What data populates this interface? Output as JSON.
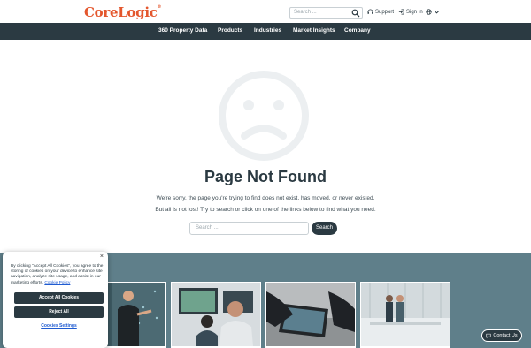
{
  "header": {
    "logo": "CoreLogic",
    "logo_mark": "®",
    "search_placeholder": "Search ...",
    "support": "Support",
    "signin": "Sign In"
  },
  "nav": {
    "items": [
      "360 Property Data",
      "Products",
      "Industries",
      "Market Insights",
      "Company"
    ]
  },
  "notfound": {
    "title": "Page Not Found",
    "line1": "We're sorry, the page you're trying to find does not exist, has moved, or never existed.",
    "line2": "But all is not lost! Try to search or click on one of the links below to find what you need.",
    "search_placeholder": "Search ...",
    "search_button": "Search"
  },
  "cookie": {
    "close": "×",
    "text": "By clicking \"Accept All Cookies\", you agree to the storing of cookies on your device to enhance site navigation, analyze site usage, and assist in our marketing efforts.",
    "policy_link": "Cookie Policy",
    "accept": "Accept All Cookies",
    "reject": "Reject All",
    "settings": "Cookies Settings"
  },
  "contact": "Contact Us",
  "colors": {
    "brand": "#e4572e",
    "navy": "#2b3a42",
    "band": "#5f7f8a"
  }
}
